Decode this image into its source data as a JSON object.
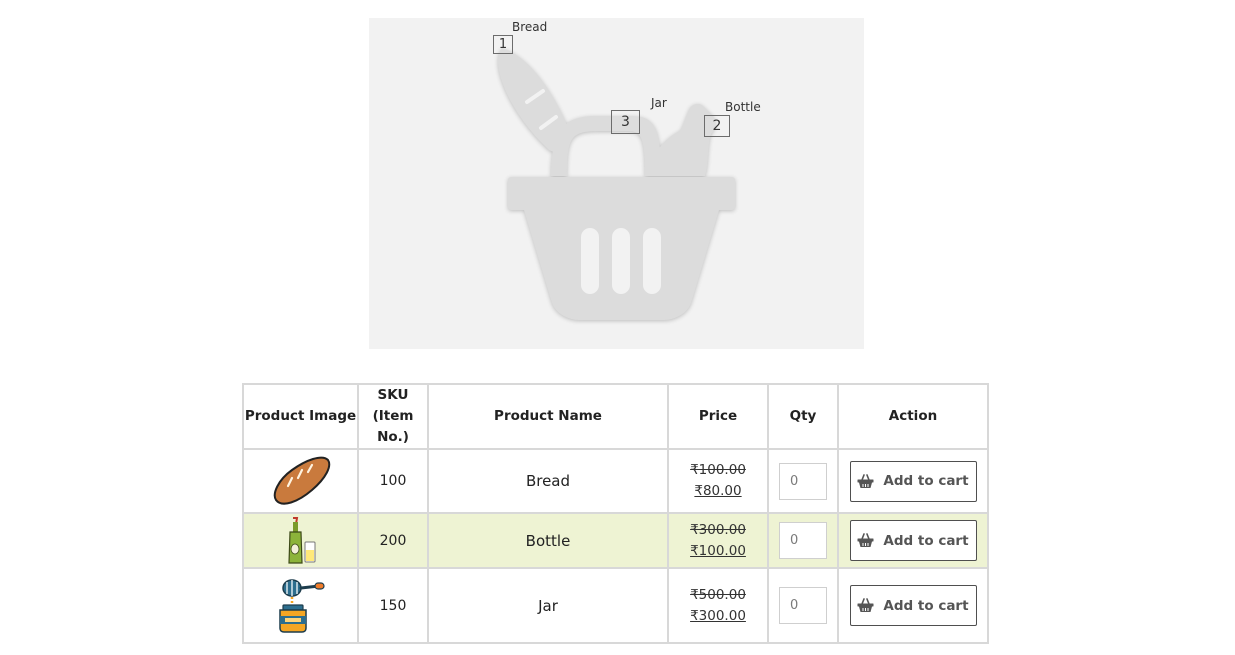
{
  "hotspots": [
    {
      "number": "1",
      "label": "Bread"
    },
    {
      "number": "2",
      "label": "Bottle"
    },
    {
      "number": "3",
      "label": "Jar"
    }
  ],
  "table": {
    "headers": {
      "image": "Product Image",
      "sku_line1": "SKU",
      "sku_line2": "(Item No.)",
      "name": "Product Name",
      "price": "Price",
      "qty": "Qty",
      "action": "Action"
    },
    "rows": [
      {
        "image_icon": "bread-icon",
        "sku": "100",
        "name": "Bread",
        "old_price": "₹100.00",
        "new_price": "₹80.00",
        "qty_placeholder": "0",
        "action_label": "Add to cart"
      },
      {
        "image_icon": "bottle-icon",
        "sku": "200",
        "name": "Bottle",
        "old_price": "₹300.00",
        "new_price": "₹100.00",
        "qty_placeholder": "0",
        "action_label": "Add to cart"
      },
      {
        "image_icon": "jar-icon",
        "sku": "150",
        "name": "Jar",
        "old_price": "₹500.00",
        "new_price": "₹300.00",
        "qty_placeholder": "0",
        "action_label": "Add to cart"
      }
    ]
  },
  "colors": {
    "highlight_row": "#eef3d3",
    "hero_background": "#f2f2f2"
  }
}
